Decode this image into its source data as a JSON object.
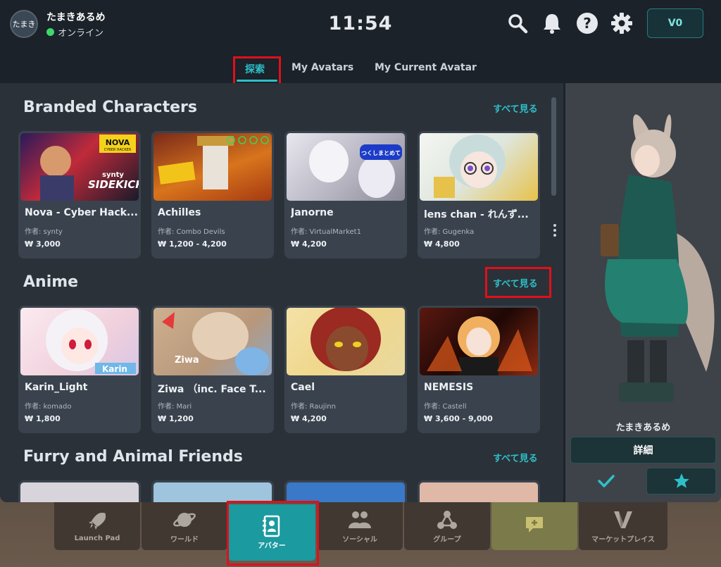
{
  "header": {
    "avatar_initials": "たまき",
    "username": "たまきあるめ",
    "status": "オンライン",
    "clock": "11:54",
    "currency_label": "V0",
    "icons": [
      "search-icon",
      "bell-icon",
      "help-icon",
      "gear-icon"
    ]
  },
  "tabs": [
    {
      "label": "探索",
      "active": true
    },
    {
      "label": "My Avatars",
      "active": false
    },
    {
      "label": "My Current Avatar",
      "active": false
    }
  ],
  "sections": [
    {
      "title": "Branded Characters",
      "see_all": "すべて見る",
      "cards": [
        {
          "name": "Nova - Cyber Hack...",
          "author": "作者: synty",
          "price": "₩ 3,000",
          "color": "#b83a3a"
        },
        {
          "name": "Achilles",
          "author": "作者: Combo Devils",
          "price": "₩ 1,200 - 4,200",
          "color": "#c8661c"
        },
        {
          "name": "Janorne",
          "author": "作者: VirtualMarket1",
          "price": "₩ 4,200",
          "color": "#b9b7c2"
        },
        {
          "name": "lens chan - れんず...",
          "author": "作者: Gugenka",
          "price": "₩ 4,800",
          "color": "#d8e0e0"
        }
      ]
    },
    {
      "title": "Anime",
      "see_all": "すべて見る",
      "cards": [
        {
          "name": "Karin_Light",
          "author": "作者: komado",
          "price": "₩ 1,800",
          "color": "#f0d6de"
        },
        {
          "name": "Ziwa （inc. Face T...",
          "author": "作者: Mari",
          "price": "₩ 1,200",
          "color": "#d3b89c"
        },
        {
          "name": "Cael",
          "author": "作者: Raujinn",
          "price": "₩ 4,200",
          "color": "#f2dfa6"
        },
        {
          "name": "NEMESIS",
          "author": "作者: Castell",
          "price": "₩ 3,600 - 9,000",
          "color": "#3a1512"
        }
      ]
    },
    {
      "title": "Furry and Animal Friends",
      "see_all": "すべて見る"
    }
  ],
  "card_overlay_text": {
    "nova_logo": "NOVA",
    "nova_sub": "CYBER HACKER",
    "nova_brand": "synty",
    "nova_sidekick": "SIDEKICK",
    "janorne_banner": "つくしまとめて",
    "karin_logo": "Karin",
    "ziwa_logo": "Ziwa"
  },
  "right_panel": {
    "avatar_name": "たまきあるめ",
    "detail_label": "詳細"
  },
  "bottom_nav": [
    {
      "label": "Launch Pad",
      "icon": "rocket-icon"
    },
    {
      "label": "ワールド",
      "icon": "planet-icon"
    },
    {
      "label": "アバター",
      "icon": "avatar-book-icon",
      "active": true
    },
    {
      "label": "ソーシャル",
      "icon": "people-icon"
    },
    {
      "label": "グループ",
      "icon": "group-icon"
    },
    {
      "label": "",
      "icon": "chat-plus-icon"
    },
    {
      "label": "マーケットプレイス",
      "icon": "vrchat-v-icon"
    }
  ],
  "colors": {
    "accent": "#2ec0c8",
    "highlight_box": "#e0101a",
    "online": "#3fd66b"
  }
}
